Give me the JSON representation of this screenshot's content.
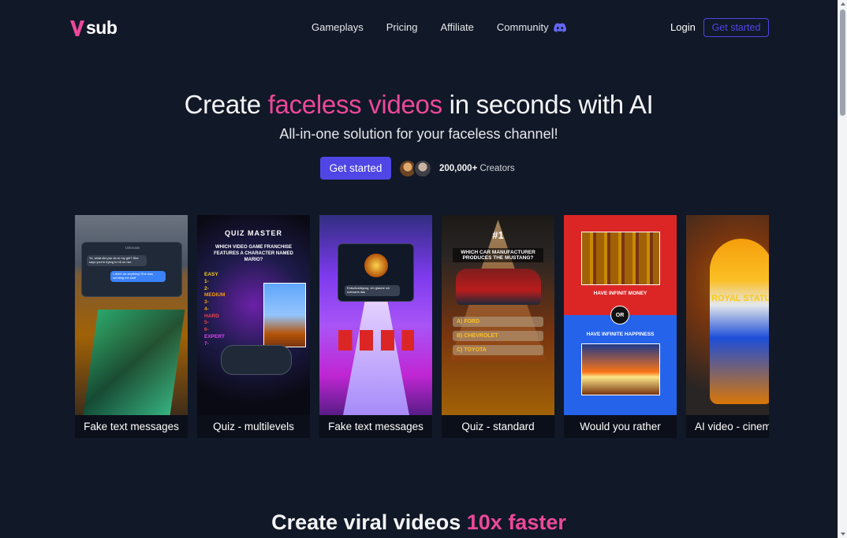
{
  "brand": {
    "name": "sub",
    "accent": "#ec4899",
    "primary": "#4f46e5"
  },
  "nav": {
    "links": [
      "Gameplays",
      "Pricing",
      "Affiliate",
      "Community"
    ],
    "login": "Login",
    "get_started": "Get started"
  },
  "hero": {
    "title_before": "Create ",
    "title_accent": "faceless videos",
    "title_after": " in seconds with AI",
    "subtitle": "All-in-one solution for your faceless channel!",
    "cta": "Get started",
    "creators_count": "200,000+",
    "creators_label": " Creators"
  },
  "cards": [
    {
      "caption": "Fake text messages",
      "contact": "Unknown",
      "msg1": "Yo, what did you do to my girl? She says you're trying to hit on her.",
      "msg2": "I didn't do anything! She was sending me stuff"
    },
    {
      "caption": "Quiz - multilevels",
      "title": "QUIZ MASTER",
      "question": "WHICH VIDEO GAME FRANCHISE FEATURES A CHARACTER NAMED MARIO?",
      "levels": [
        "EASY",
        "1-",
        "2-",
        "MEDIUM",
        "3-",
        "4-",
        "HARD",
        "5-",
        "6-",
        "EXPERT",
        "7-"
      ]
    },
    {
      "caption": "Fake text messages",
      "msg": "Entschuldigung, ich glaube ich schwank das"
    },
    {
      "caption": "Quiz - standard",
      "number": "#1",
      "question": "WHICH CAR MANUFACTURER PRODUCES THE MUSTANG?",
      "answers": [
        "A) FORD",
        "B) CHEVROLET",
        "C) TOYOTA"
      ]
    },
    {
      "caption": "Would you rather",
      "option_a": "HAVE INFINIT MONEY",
      "or": "OR",
      "option_b": "HAVE INFINITE HAPPINESS"
    },
    {
      "caption": "AI video - cinematic",
      "overlay": "ROYAL STATUE"
    }
  ],
  "section": {
    "title_before": "Create viral videos ",
    "title_accent": "10x faster"
  }
}
